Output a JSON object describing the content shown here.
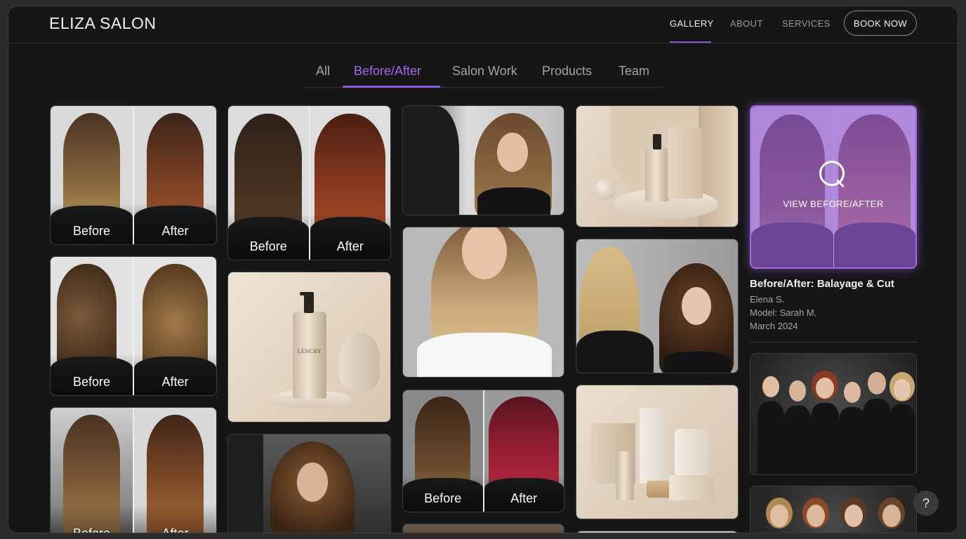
{
  "header": {
    "brand": "ELIZA SALON",
    "nav": [
      {
        "label": "GALLERY",
        "active": true
      },
      {
        "label": "ABOUT",
        "active": false
      },
      {
        "label": "SERVICES",
        "active": false
      }
    ],
    "cta": "BOOK NOW"
  },
  "filters": {
    "tabs": [
      "All",
      "Before/After",
      "Salon Work",
      "Products",
      "Team"
    ],
    "active": "Before/After"
  },
  "labels": {
    "before": "Before",
    "after": "After"
  },
  "gallery": {
    "c1": [
      {
        "type": "before-after",
        "before_label": "Before",
        "after_label": "After"
      },
      {
        "type": "before-after",
        "before_label": "Before",
        "after_label": "After"
      },
      {
        "type": "before-after",
        "before_label": "Before",
        "after_label": "After"
      }
    ],
    "c2": [
      {
        "type": "before-after",
        "before_label": "Before",
        "after_label": "After"
      },
      {
        "type": "product",
        "product_text": "LENCRY"
      },
      {
        "type": "salon-work"
      }
    ],
    "c3": [
      {
        "type": "salon-work"
      },
      {
        "type": "salon-work"
      },
      {
        "type": "before-after",
        "before_label": "Before",
        "after_label": "After"
      }
    ],
    "c4": [
      {
        "type": "product"
      },
      {
        "type": "salon-work"
      },
      {
        "type": "product"
      }
    ],
    "c5": [
      {
        "type": "before-after-featured"
      },
      {
        "type": "team"
      },
      {
        "type": "team"
      }
    ]
  },
  "featured": {
    "overlay_text": "VIEW BEFORE/AFTER",
    "title": "Before/After: Balayage & Cut",
    "stylist": "Elena S.",
    "model": "Model: Sarah M.",
    "date": "March 2024"
  },
  "help": "?",
  "colors": {
    "accent": "#a368ea",
    "accent_dark": "#8e55d8",
    "background": "#161616"
  }
}
